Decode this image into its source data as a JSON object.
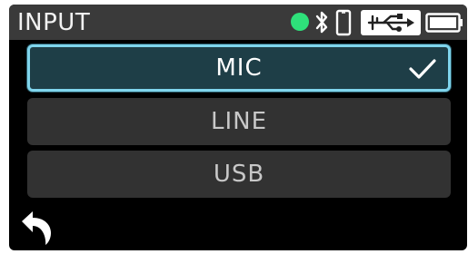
{
  "header": {
    "title": "INPUT",
    "icons": [
      "status-dot-icon",
      "bluetooth-icon",
      "phone-icon",
      "usb-icon",
      "battery-icon"
    ],
    "status_dot_color": "#2ee07a"
  },
  "options": [
    {
      "label": "MIC",
      "selected": true
    },
    {
      "label": "LINE",
      "selected": false
    },
    {
      "label": "USB",
      "selected": false
    }
  ],
  "footer": {
    "back_icon": "back-arrow-icon"
  },
  "colors": {
    "selected_border": "#7fd4ec",
    "selected_fill": "#1e3e47",
    "option_fill": "#323232",
    "header_fill": "#3a3a3a"
  }
}
